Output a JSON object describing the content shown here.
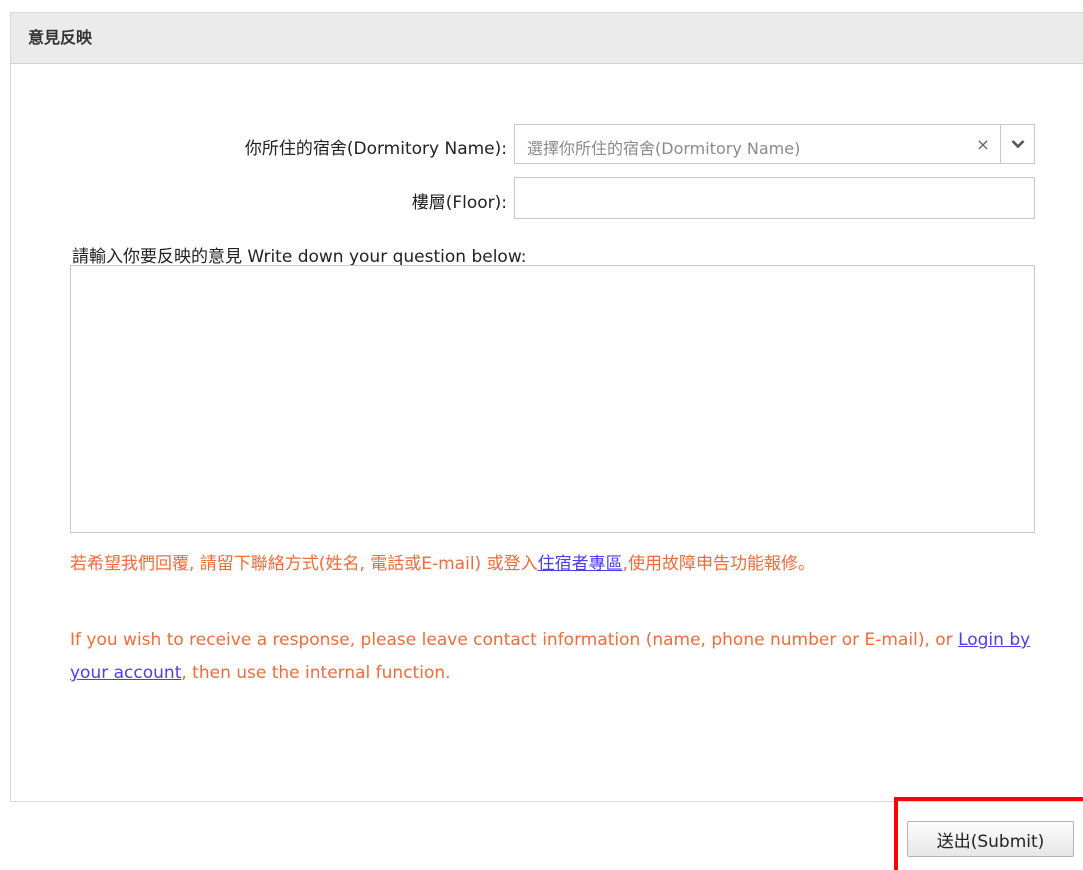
{
  "panel": {
    "title": "意見反映"
  },
  "form": {
    "dormitory": {
      "label": "你所住的宿舍(Dormitory Name):",
      "placeholder": "選擇你所住的宿舍(Dormitory Name)",
      "clear_symbol": "×"
    },
    "floor": {
      "label": "樓層(Floor):",
      "value": ""
    },
    "question": {
      "label": "請輸入你要反映的意見 Write down your question below:",
      "value": ""
    }
  },
  "notice": {
    "zh_before": "若希望我們回覆, 請留下聯絡方式(姓名, 電話或E-mail) 或登入",
    "zh_link": "住宿者專區",
    "zh_after": ",使用故障申告功能報修。",
    "en_before": "If you wish to receive a response, please leave contact information (name, phone number or E-mail), or ",
    "en_link": "Login by your account",
    "en_after": ", then use the internal function.",
    "color": "#f26b38",
    "link_color": "#4b3df2"
  },
  "actions": {
    "submit_label": "送出(Submit)",
    "highlight_color": "#ff0000"
  }
}
